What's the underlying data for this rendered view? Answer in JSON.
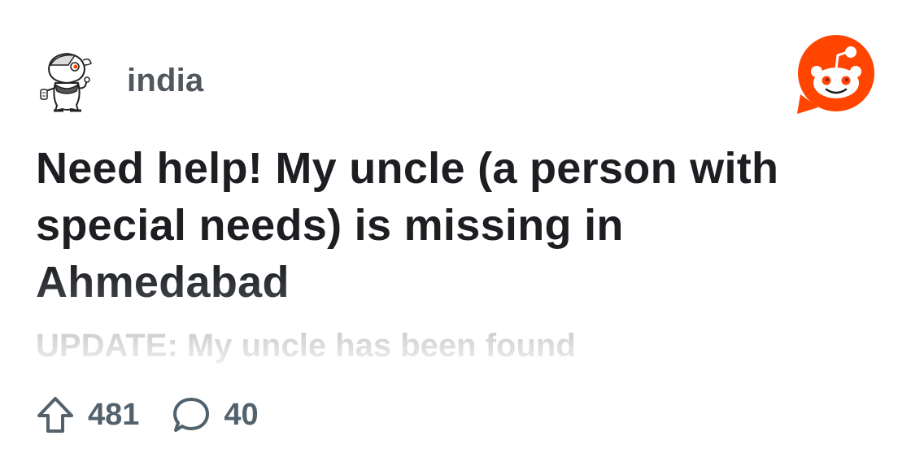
{
  "subreddit": {
    "name": "india",
    "avatar_icon": "snoo-avatar-icon"
  },
  "brand": {
    "logo_icon": "reddit-logo-icon",
    "color": "#ff4500"
  },
  "post": {
    "title": "Need help! My uncle (a person with special needs) is missing in Ahmedabad",
    "subtitle": "UPDATE: My uncle has been found"
  },
  "stats": {
    "upvotes": "481",
    "upvote_icon": "upvote-arrow-icon",
    "comments": "40",
    "comment_icon": "comment-bubble-icon",
    "color": "#52616b"
  }
}
